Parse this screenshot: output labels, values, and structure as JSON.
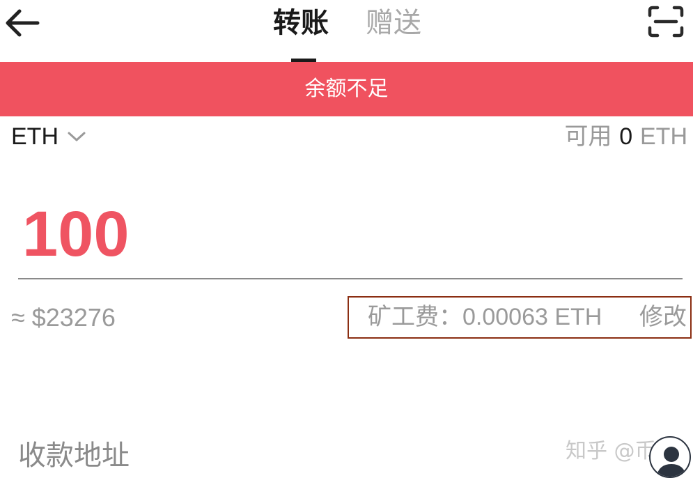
{
  "header": {
    "back_icon": "arrow-left-icon",
    "tabs": [
      {
        "label": "转账",
        "active": true
      },
      {
        "label": "赠送",
        "active": false
      }
    ],
    "scan_icon": "scan-icon"
  },
  "alert": {
    "text": "余额不足",
    "color": "#f0525f"
  },
  "token": {
    "name": "ETH",
    "dropdown_icon": "chevron-down-icon"
  },
  "available": {
    "label": "可用",
    "value": "0",
    "unit": "ETH"
  },
  "amount": {
    "value": "100",
    "color": "#ef5462"
  },
  "fiat_value": "≈ $23276",
  "fee": {
    "label": "矿工费：",
    "value": "0.00063 ETH",
    "edit_label": "修改",
    "highlight_color": "#8b2e12"
  },
  "address": {
    "label": "收款地址"
  },
  "watermark": {
    "text": "知乎 @币说"
  }
}
